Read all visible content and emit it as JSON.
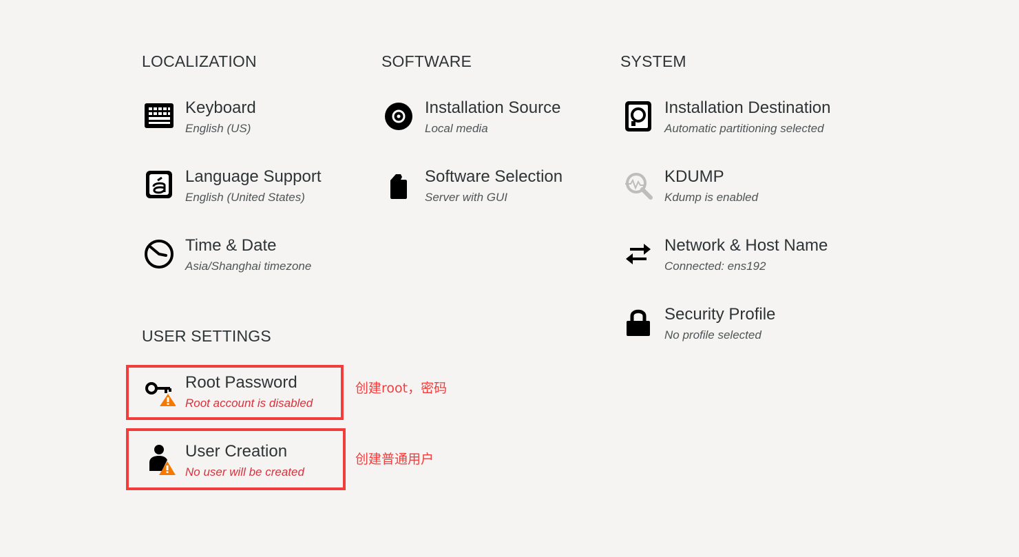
{
  "sections": {
    "localization": {
      "title": "LOCALIZATION",
      "spokes": [
        {
          "title": "Keyboard",
          "status": "English (US)",
          "icon": "keyboard-icon"
        },
        {
          "title": "Language Support",
          "status": "English (United States)",
          "icon": "language-icon"
        },
        {
          "title": "Time & Date",
          "status": "Asia/Shanghai timezone",
          "icon": "clock-icon"
        }
      ]
    },
    "software": {
      "title": "SOFTWARE",
      "spokes": [
        {
          "title": "Installation Source",
          "status": "Local media",
          "icon": "optical-disc-icon"
        },
        {
          "title": "Software Selection",
          "status": "Server with GUI",
          "icon": "package-icon"
        }
      ]
    },
    "system": {
      "title": "SYSTEM",
      "spokes": [
        {
          "title": "Installation Destination",
          "status": "Automatic partitioning selected",
          "icon": "hard-disk-icon"
        },
        {
          "title": "KDUMP",
          "status": "Kdump is enabled",
          "icon": "kdump-search-icon"
        },
        {
          "title": "Network & Host Name",
          "status": "Connected: ens192",
          "icon": "network-arrows-icon"
        },
        {
          "title": "Security Profile",
          "status": "No profile selected",
          "icon": "lock-icon"
        }
      ]
    },
    "user_settings": {
      "title": "USER SETTINGS",
      "spokes": [
        {
          "title": "Root Password",
          "status": "Root account is disabled",
          "icon": "key-warning-icon",
          "warning": true
        },
        {
          "title": "User Creation",
          "status": "No user will be created",
          "icon": "user-warning-icon",
          "warning": true
        }
      ]
    }
  },
  "annotations": {
    "root_password": "创建root，密码",
    "user_creation": "创建普通用户"
  },
  "colors": {
    "background": "#f5f4f2",
    "text": "#2e3436",
    "warning_text": "#d8323c",
    "warning_badge": "#f57900",
    "annotation": "#f23d3d"
  }
}
